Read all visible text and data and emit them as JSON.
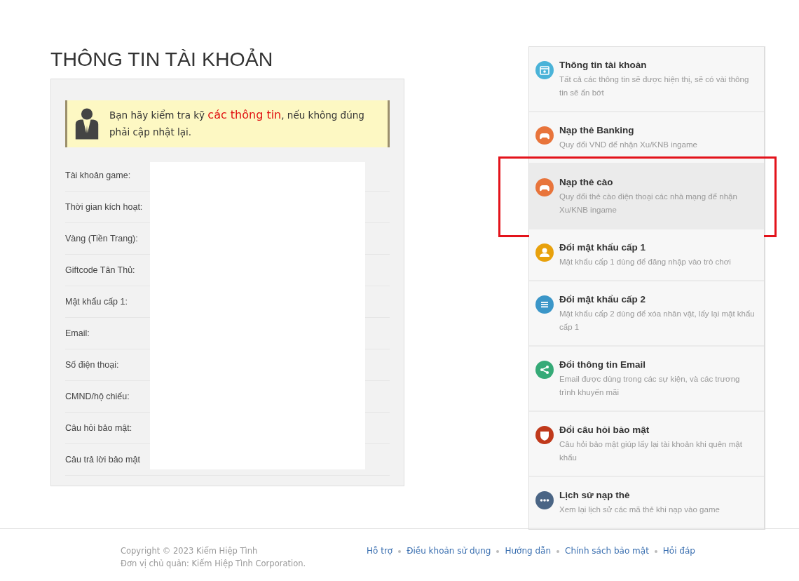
{
  "page_title": "THÔNG TIN TÀI KHOẢN",
  "notice": {
    "text": "Bạn hãy kiểm tra kỹ **các thông tin**, nếu không đúng phải cập nhật lại."
  },
  "account_fields": [
    {
      "label": "Tài khoản game:"
    },
    {
      "label": "Thời gian kích hoạt:"
    },
    {
      "label": "Vàng (Tiền Trang):"
    },
    {
      "label": "Giftcode Tân Thủ:"
    },
    {
      "label": "Mật khẩu cấp 1:"
    },
    {
      "label": "Email:"
    },
    {
      "label": "Số điện thoại:"
    },
    {
      "label": "CMND/hộ chiếu:"
    },
    {
      "label": "Câu hỏi bảo mật:"
    },
    {
      "label": "Câu trả lời bảo mật"
    }
  ],
  "sidebar": {
    "items": [
      {
        "title": "Thông tin tài khoản",
        "description": "Tất cả các thông tin sẽ được hiện thị, sẽ có vài thông tin sẽ ẩn bớt",
        "color": "#4ab3d8",
        "selected": false,
        "outlined": false
      },
      {
        "title": "Nạp thẻ Banking",
        "description": "Quy đổi VND để nhận Xu/KNB ingame",
        "color": "#e8743b",
        "selected": false,
        "outlined": false
      },
      {
        "title": "Nạp thẻ cào",
        "description": "Quy đổi thẻ cào điện thoại các nhà mạng để nhận Xu/KNB ingame",
        "color": "#e8743b",
        "selected": true,
        "outlined": true
      },
      {
        "title": "Đổi mật khẩu cấp 1",
        "description": "Mật khẩu cấp 1 dùng để đăng nhập vào trò chơi",
        "color": "#e8a10c",
        "selected": false,
        "outlined": false
      },
      {
        "title": "Đổi mật khẩu cấp 2",
        "description": "Mật khẩu cấp 2 dùng để xóa nhân vật, lấy lại mật khẩu cấp 1",
        "color": "#3b96c8",
        "selected": false,
        "outlined": false
      },
      {
        "title": "Đổi thông tin Email",
        "description": "Email được dùng trong các sự kiện, và các trương trình khuyến mãi",
        "color": "#35aa77",
        "selected": false,
        "outlined": false
      },
      {
        "title": "Đổi câu hỏi bảo mật",
        "description": "Câu hỏi bảo mật giúp lấy lại tài khoản khi quên mật khẩu",
        "color": "#c0391b",
        "selected": false,
        "outlined": false
      },
      {
        "title": "Lịch sử nạp thẻ",
        "description": "Xem lại lịch sử các mã thẻ khi nạp vào game",
        "color": "#4a6585",
        "selected": false,
        "outlined": false
      }
    ]
  },
  "footer": {
    "copyright": "Copyright © 2023 Kiếm Hiệp Tình",
    "owner": "Đơn vị chủ quản: Kiếm Hiệp Tình Corporation.",
    "links": [
      "Hỗ trợ",
      "Điều khoản sử dụng",
      "Hướng dẫn",
      "Chính sách bảo mật",
      "Hỏi đáp"
    ]
  }
}
